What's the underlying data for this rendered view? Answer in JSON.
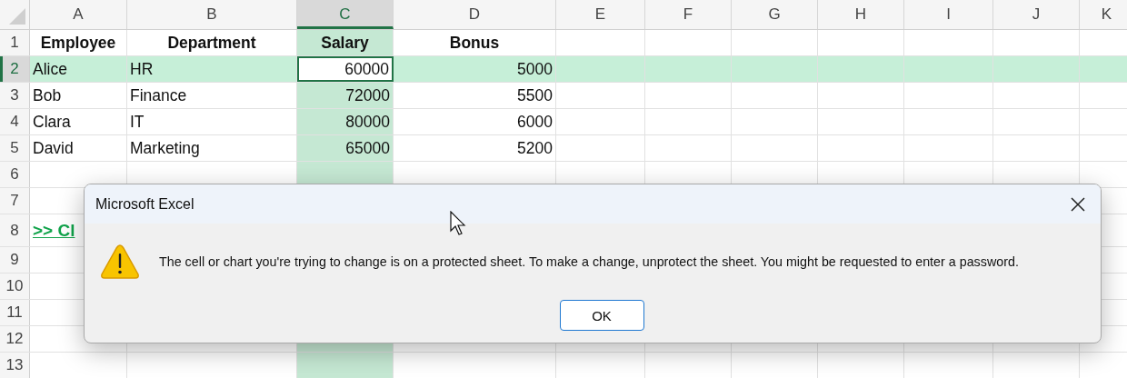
{
  "columns": [
    {
      "label": "A",
      "selected": false
    },
    {
      "label": "B",
      "selected": false
    },
    {
      "label": "C",
      "selected": true
    },
    {
      "label": "D",
      "selected": false
    },
    {
      "label": "E",
      "selected": false
    },
    {
      "label": "F",
      "selected": false
    },
    {
      "label": "G",
      "selected": false
    },
    {
      "label": "H",
      "selected": false
    },
    {
      "label": "I",
      "selected": false
    },
    {
      "label": "J",
      "selected": false
    },
    {
      "label": "K",
      "selected": false
    }
  ],
  "rows": [
    {
      "number": "1",
      "selected": false,
      "kind": "header",
      "cells": [
        {
          "text": "Employee",
          "kind": "text",
          "active": false
        },
        {
          "text": "Department",
          "kind": "text",
          "active": false
        },
        {
          "text": "Salary",
          "kind": "text",
          "active": false
        },
        {
          "text": "Bonus",
          "kind": "text",
          "active": false
        }
      ]
    },
    {
      "number": "2",
      "selected": true,
      "kind": "data",
      "cells": [
        {
          "text": "Alice",
          "kind": "text",
          "active": false
        },
        {
          "text": "HR",
          "kind": "text",
          "active": false
        },
        {
          "text": "60000",
          "kind": "number",
          "active": true
        },
        {
          "text": "5000",
          "kind": "number",
          "active": false
        }
      ]
    },
    {
      "number": "3",
      "selected": false,
      "kind": "data",
      "cells": [
        {
          "text": "Bob",
          "kind": "text",
          "active": false
        },
        {
          "text": "Finance",
          "kind": "text",
          "active": false
        },
        {
          "text": "72000",
          "kind": "number",
          "active": false
        },
        {
          "text": "5500",
          "kind": "number",
          "active": false
        }
      ]
    },
    {
      "number": "4",
      "selected": false,
      "kind": "data",
      "cells": [
        {
          "text": "Clara",
          "kind": "text",
          "active": false
        },
        {
          "text": "IT",
          "kind": "text",
          "active": false
        },
        {
          "text": "80000",
          "kind": "number",
          "active": false
        },
        {
          "text": "6000",
          "kind": "number",
          "active": false
        }
      ]
    },
    {
      "number": "5",
      "selected": false,
      "kind": "data",
      "cells": [
        {
          "text": "David",
          "kind": "text",
          "active": false
        },
        {
          "text": "Marketing",
          "kind": "text",
          "active": false
        },
        {
          "text": "65000",
          "kind": "number",
          "active": false
        },
        {
          "text": "5200",
          "kind": "number",
          "active": false
        }
      ]
    },
    {
      "number": "6",
      "selected": false,
      "kind": "data",
      "cells": []
    },
    {
      "number": "7",
      "selected": false,
      "kind": "data",
      "cells": []
    },
    {
      "number": "8",
      "selected": false,
      "kind": "tall",
      "cells": [
        {
          "text": ">> Cl",
          "kind": "link",
          "active": false
        }
      ]
    },
    {
      "number": "9",
      "selected": false,
      "kind": "data",
      "cells": []
    },
    {
      "number": "10",
      "selected": false,
      "kind": "data",
      "cells": []
    },
    {
      "number": "11",
      "selected": false,
      "kind": "data",
      "cells": []
    },
    {
      "number": "12",
      "selected": false,
      "kind": "data",
      "cells": []
    },
    {
      "number": "13",
      "selected": false,
      "kind": "data",
      "cells": []
    }
  ],
  "dialog": {
    "title": "Microsoft Excel",
    "message": "The cell or chart you're trying to change is on a protected sheet. To make a change, unprotect the sheet. You might be requested to enter a password.",
    "buttons": [
      "OK"
    ]
  }
}
